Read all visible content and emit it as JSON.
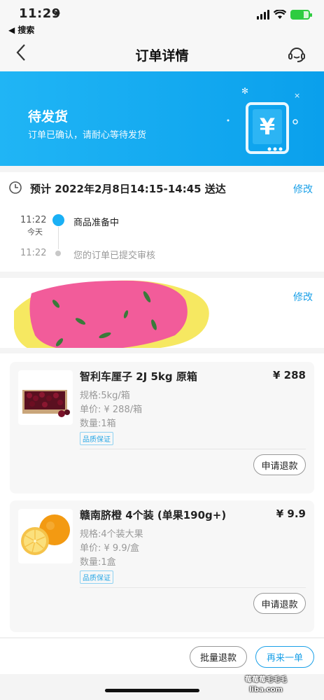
{
  "status_bar": {
    "time": "11:29",
    "back_app": "◀ 搜索"
  },
  "nav": {
    "title": "订单详情"
  },
  "banner": {
    "title": "待发货",
    "subtitle": "订单已确认，请耐心等待发货",
    "colors": {
      "bg_start": "#20b5f5",
      "bg_end": "#0aa0ec"
    }
  },
  "eta": {
    "text": "预计 2022年2月8日14:15-14:45 送达",
    "modify_label": "修改",
    "timeline": [
      {
        "time": "11:22",
        "day": "今天",
        "text": "商品准备中",
        "active": true
      },
      {
        "time": "11:22",
        "text": "您的订单已提交审核",
        "active": false
      }
    ]
  },
  "address": {
    "modify_label": "修改"
  },
  "products": [
    {
      "name": "智利车厘子 2J 5kg 原箱",
      "price": "¥ 288",
      "spec": "规格:5kg/箱",
      "unit_price": "单价: ¥ 288/箱",
      "quantity": "数量:1箱",
      "badge": "品质保证",
      "refund_label": "申请退款",
      "image_icon": "cherries-box-icon"
    },
    {
      "name": "赣南脐橙 4个装 (单果190g+)",
      "price": "¥ 9.9",
      "spec": "规格:4个装大果",
      "unit_price": "单价: ¥ 9.9/盒",
      "quantity": "数量:1盒",
      "badge": "品质保证",
      "refund_label": "申请退款",
      "image_icon": "oranges-icon"
    }
  ],
  "footer": {
    "batch_refund_label": "批量退款",
    "reorder_label": "再来一单"
  },
  "watermark": {
    "line1": "莓莓莓毛毛毛",
    "line2": "liba.com"
  },
  "colors": {
    "accent": "#1aa0e8",
    "badge": "#2aa8e6"
  }
}
